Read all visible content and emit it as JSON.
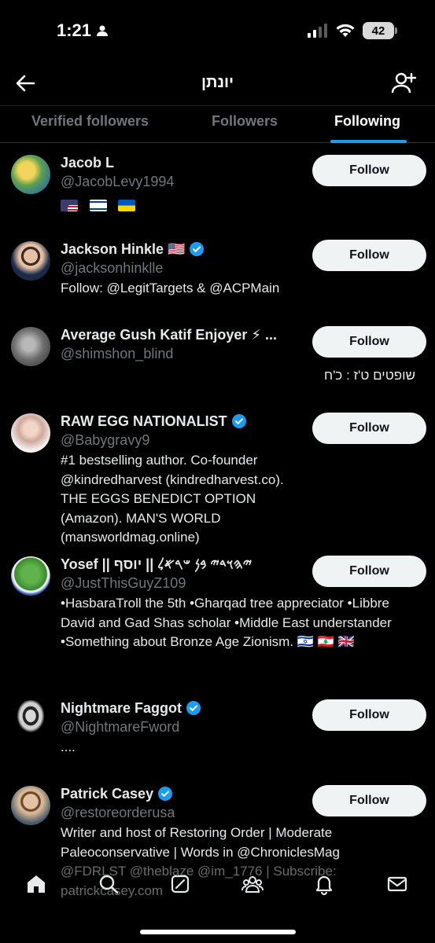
{
  "status_bar": {
    "time": "1:21",
    "battery": "42"
  },
  "header": {
    "title": "יונתן"
  },
  "tabs": [
    {
      "label": "Verified followers"
    },
    {
      "label": "Followers"
    },
    {
      "label": "Following"
    }
  ],
  "users": [
    {
      "name": "Jacob L",
      "handle": "@JacobLevy1994",
      "verified": false,
      "bio": "",
      "flags": [
        "us",
        "il",
        "ua"
      ],
      "follow_label": "Follow"
    },
    {
      "name": "Jackson Hinkle 🇺🇸",
      "handle": "@jacksonhinklle",
      "verified": true,
      "bio": "Follow: @LegitTargets & @ACPMain",
      "follow_label": "Follow"
    },
    {
      "name": "Average Gush Katif Enjoyer ⚡ ...",
      "handle": "@shimshon_blind",
      "verified": false,
      "bio": "שופטים ט'ז : כ'ח",
      "follow_label": "Follow"
    },
    {
      "name": "RAW EGG NATIONALIST",
      "handle": "@Babygravy9",
      "verified": true,
      "bio": "#1 bestselling author. Co-founder @kindredharvest (kindredharvest.co). THE EGGS BENEDICT OPTION (Amazon). MAN'S WORLD (mansworldmag.online)",
      "follow_label": "Follow"
    },
    {
      "name": "Yosef || 𐤉𐤄𐤅𐤃𐤉 𐤁𐤍 𐤔𐤓𐤀𐤋 || יוסף",
      "handle": "@JustThisGuyZ109",
      "verified": false,
      "bio": "•HasbaraTroll the 5th •Gharqad tree appreciator •Libbre David and Gad Shas scholar •Middle East understander •Something about Bronze Age Zionism. 🇮🇱 🇱🇧 🇬🇧",
      "follow_label": "Follow"
    },
    {
      "name": "Nightmare Faggot",
      "handle": "@NightmareFword",
      "verified": true,
      "bio": "....",
      "follow_label": "Follow"
    },
    {
      "name": "Patrick Casey",
      "handle": "@restoreorderusa",
      "verified": true,
      "bio": "Writer and host of Restoring Order | Moderate Paleoconservative | Words in @ChroniclesMag @FDRLST @theblaze @im_1776 | Subscribe: patrickcasey.com",
      "follow_label": "Follow"
    }
  ],
  "bottom_nav": [
    "home-icon",
    "search-icon",
    "grok-icon",
    "communities-icon",
    "notifications-icon",
    "messages-icon"
  ],
  "colors": {
    "accent": "#1d9bf0",
    "background": "#000000",
    "muted": "#71767b",
    "button": "#eff3f4"
  }
}
